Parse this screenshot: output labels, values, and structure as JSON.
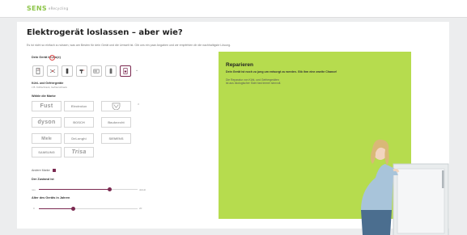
{
  "header": {
    "logo_text": "SENS",
    "logo_sub": "eRecycling"
  },
  "page": {
    "title": "Elektrogerät loslassen – aber wie?",
    "intro": "Es ist nicht so einfach zu wissen, was am Besten für dein Gerät und die Umwelt ist. Gib uns ein paar Angaben und wir empfehlen dir die nachhaltigste Lösung."
  },
  "device": {
    "label": "Dein Gerät ist ein(e)",
    "icons": [
      "fridge-icon",
      "fan-icon",
      "phone-icon",
      "drill-icon",
      "microwave-icon",
      "battery-icon",
      "washing-machine-icon"
    ],
    "selected_index": 6,
    "selected_name": "Kühl- und Gefriergeräte",
    "selected_sub": "z.B. Kühlschrank, Gefrierschrank"
  },
  "brands": {
    "label": "Wähle die Marke",
    "items": [
      "Fust",
      "Electrolux",
      "V-ZUG",
      "dyson",
      "BOSCH",
      "Bauknecht",
      "Miele",
      "DeLonghi",
      "SIEMENS",
      "SAMSUNG",
      "Trisa"
    ],
    "other_label": "Andere Marke"
  },
  "condition": {
    "label": "Der Zustand ist",
    "min_label": "neu",
    "max_label": "defekt",
    "value": 0.72
  },
  "age": {
    "label": "Alter des Geräts in Jahren",
    "min_label": "0",
    "max_label": "20",
    "value": 0.35
  },
  "recommendation": {
    "title": "Reparieren",
    "subtitle": "Dein Gerät ist noch zu jung um entsorgt zu werden. Gib ihm eine zweite Chance!",
    "body": "Die Reparatur von Kühl- und Gefriergeräten ist aus ökologischer Sicht fast immer sinnvoll.",
    "bg_color": "#b6dc4e"
  },
  "colors": {
    "accent": "#7a2950",
    "logo": "#8ec54a"
  }
}
